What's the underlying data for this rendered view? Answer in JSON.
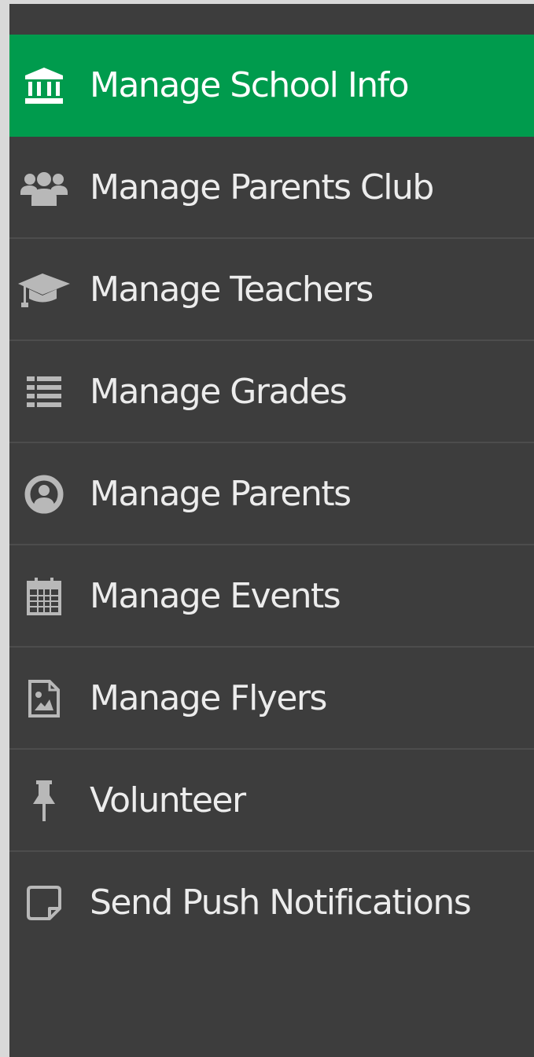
{
  "sidebar": {
    "items": [
      {
        "label": "Manage School Info",
        "icon": "bank-icon",
        "active": true
      },
      {
        "label": "Manage Parents Club",
        "icon": "users-icon",
        "active": false
      },
      {
        "label": "Manage Teachers",
        "icon": "graduation-cap-icon",
        "active": false
      },
      {
        "label": "Manage Grades",
        "icon": "list-icon",
        "active": false
      },
      {
        "label": "Manage Parents",
        "icon": "user-circle-icon",
        "active": false
      },
      {
        "label": "Manage Events",
        "icon": "calendar-icon",
        "active": false
      },
      {
        "label": "Manage Flyers",
        "icon": "image-file-icon",
        "active": false
      },
      {
        "label": "Volunteer",
        "icon": "thumbtack-icon",
        "active": false
      },
      {
        "label": "Send Push Notifications",
        "icon": "sticky-note-icon",
        "active": false
      }
    ]
  },
  "colors": {
    "sidebar_background": "#3d3d3d",
    "active_background": "#009b4d",
    "text": "#ececec",
    "icon": "#b8b8b8",
    "divider": "#4d4d4d",
    "frame": "#d9d9d9"
  }
}
